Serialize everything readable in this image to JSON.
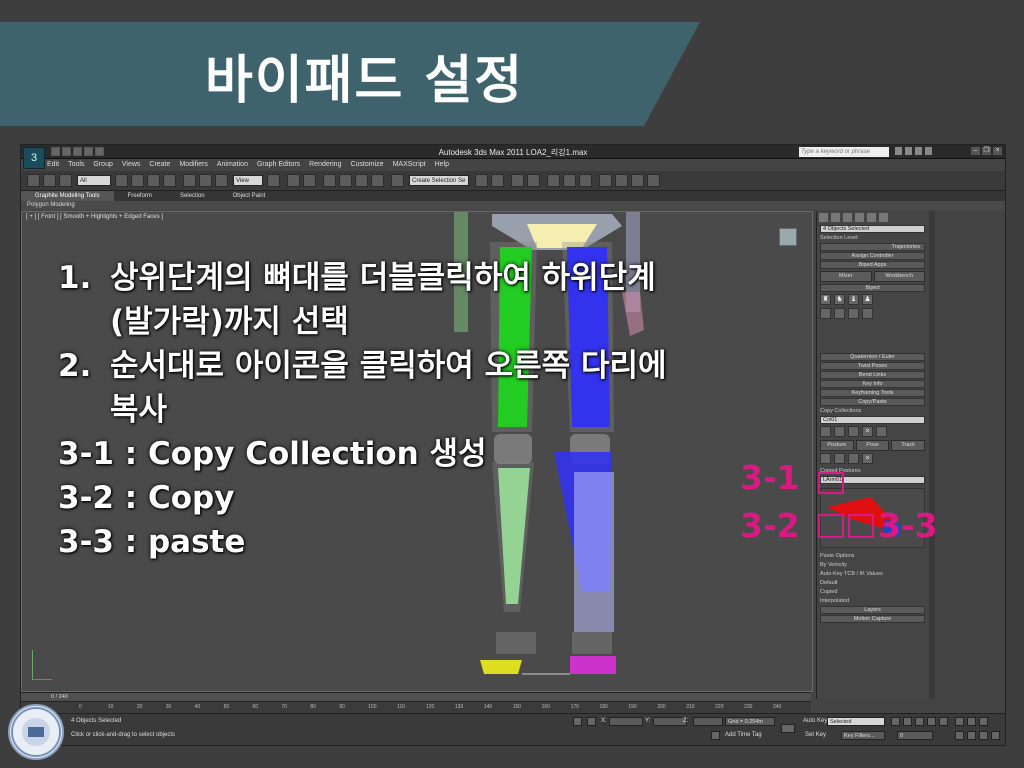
{
  "slide": {
    "title": "바이패드 설정"
  },
  "app": {
    "window_title": "Autodesk 3ds Max  2011      LOA2_리깅1.max",
    "logo": "3",
    "search_placeholder": "Type a keyword or phrase",
    "menu": [
      "Edit",
      "Tools",
      "Group",
      "Views",
      "Create",
      "Modifiers",
      "Animation",
      "Graph Editors",
      "Rendering",
      "Customize",
      "MAXScript",
      "Help"
    ],
    "toolbar": {
      "filter_dropdown": "All",
      "view_dropdown": "View",
      "selection_set": "Create Selection Se"
    },
    "ribbon_tabs": [
      "Graphite Modeling Tools",
      "Freeform",
      "Selection",
      "Object Paint"
    ],
    "ribbon_sub": "Polygon Modeling",
    "viewport_label": "[ + ] [ Front ] [ Smooth + Highlights + Edged Faces ]"
  },
  "instructions": {
    "item1_num": "1.",
    "item1_line1": "상위단계의 뼈대를 더블클릭하여 하위단계",
    "item1_line2": "(발가락)까지 선택",
    "item2_num": "2.",
    "item2_line1": "순서대로 아이콘을 클릭하여 오른쪽 다리에",
    "item2_line2": "복사",
    "item3": "3-1 : Copy Collection 생성",
    "item4": "3-2 : Copy",
    "item5": "3-3 : paste"
  },
  "markers": {
    "m31": "3-1",
    "m32": "3-2",
    "m33": "3-3"
  },
  "command_panel": {
    "objects_selected": "4 Objects Selected",
    "selection_level": "Selection Level:",
    "trajectories": "Trajectories",
    "assign_controller": "Assign Controller",
    "biped_apps": "Biped Apps",
    "mixer": "Mixer",
    "workbench": "Workbench",
    "biped": "Biped",
    "quaternion": "Quaternion / Euler",
    "twist_poses": "Twist Poses",
    "bend_links": "Bend Links",
    "key_info": "Key Info",
    "keyframing_tools": "Keyframing Tools",
    "copy_paste": "Copy/Paste",
    "copy_collections": "Copy Collections",
    "collection_name": "Col01",
    "tab_posture": "Posture",
    "tab_pose": "Pose",
    "tab_track": "Track",
    "copied_postures": "Copied Postures",
    "posture_name": "LArm01",
    "paste_options": "Paste Options",
    "by_velocity": "By Velocity",
    "auto_key": "Auto-Key TCB / IK Values",
    "opt_default": "Default",
    "opt_copied": "Copied",
    "opt_interpolated": "Interpolated",
    "layers": "Layers",
    "motion_capture": "Motion Capture"
  },
  "timeline": {
    "frame": "0 / 240",
    "ticks": [
      "0",
      "10",
      "20",
      "30",
      "40",
      "50",
      "60",
      "70",
      "80",
      "90",
      "100",
      "110",
      "120",
      "130",
      "140",
      "150",
      "160",
      "170",
      "180",
      "190",
      "200",
      "210",
      "220",
      "230",
      "240"
    ]
  },
  "status": {
    "selected": "4 Objects Selected",
    "prompt": "Click or click-and-drag to select objects",
    "x_label": "X:",
    "y_label": "Y:",
    "z_label": "Z:",
    "grid": "Grid = 0.254m",
    "add_time_tag": "Add Time Tag",
    "auto_key": "Auto Key",
    "selected_dropdown": "Selected",
    "set_key": "Set Key",
    "key_filters": "Key Filters...",
    "frame_field": "0"
  },
  "colors": {
    "title_band": "#3f636c",
    "marker": "#d81a83",
    "left_leg": "#22cc22",
    "right_leg": "#3333ee",
    "foot_left": "#dddd22",
    "foot_right": "#cc33cc"
  }
}
